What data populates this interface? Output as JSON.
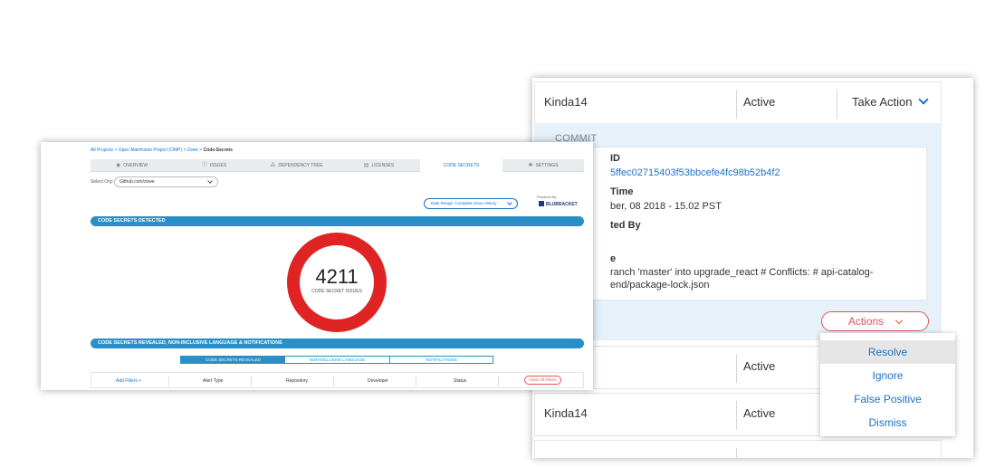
{
  "detail_panel": {
    "rows": [
      {
        "name": "Kinda14",
        "status": "Active",
        "action": "Take Action"
      },
      {
        "name": "",
        "status": "Active",
        "action": ""
      },
      {
        "name": "Kinda14",
        "status": "Active",
        "action": ""
      }
    ],
    "commit_title": "COMMIT",
    "commit": {
      "id_label": "ID",
      "id_value": "5ffec02715403f53bbcefe4fc98b52b4f2",
      "time_label": "Time",
      "time_value": "ber, 08 2018 - 15.02 PST",
      "committed_label": "ted By",
      "message_label": "e",
      "message_line1": "ranch 'master' into upgrade_react # Conflicts: # api-catalog-",
      "message_line2": "end/package-lock.json"
    },
    "actions_label": "Actions",
    "actions_menu": [
      "Resolve",
      "Ignore",
      "False Positive",
      "Dismiss"
    ],
    "selected_action": "Resolve"
  },
  "main_panel": {
    "breadcrumb": {
      "links": "All Projects > Open Mainframe Project (OMP) > Zowe > ",
      "current": "Code-Secrets"
    },
    "tabs": [
      {
        "label": "OVERVIEW",
        "icon": "globe-icon",
        "glyph": "◉"
      },
      {
        "label": "ISSUES",
        "icon": "alert-icon",
        "glyph": "ⓘ"
      },
      {
        "label": "DEPENDENCY TREE",
        "icon": "tree-icon",
        "glyph": "⁂"
      },
      {
        "label": "LICENSES",
        "icon": "document-icon",
        "glyph": "▤"
      },
      {
        "label": "CODE SECRETS",
        "icon": "",
        "glyph": ""
      },
      {
        "label": "SETTINGS",
        "icon": "gear-icon",
        "glyph": "✱"
      }
    ],
    "active_tab": "CODE SECRETS",
    "select_org_label": "Select Org:",
    "select_org_value": "Github.com/zowe",
    "date_range": "Date Range: Complete Scan History",
    "powered_by": "Powered By",
    "brand": "BLUBRACKET",
    "section1_title": "CODE SECRETS DETECTED",
    "total_issues": "4211",
    "total_issues_label": "CODE SECRET ISSUES",
    "donut_color": "#e02424",
    "section2_title": "CODE SECRETS REVEALED, NON-INCLUSIVE LANGUAGE & NOTIFICATIONS",
    "subtabs": [
      "CODE SECRETS REVEALED",
      "NON-INCLUSIVE LANGUAGE",
      "NOTIFICATIONS"
    ],
    "filters": {
      "add_filters": "Add Filters  +",
      "columns": [
        "Alert Type",
        "Repository",
        "Developer",
        "Status"
      ],
      "clear": "Clear All Filters"
    }
  }
}
